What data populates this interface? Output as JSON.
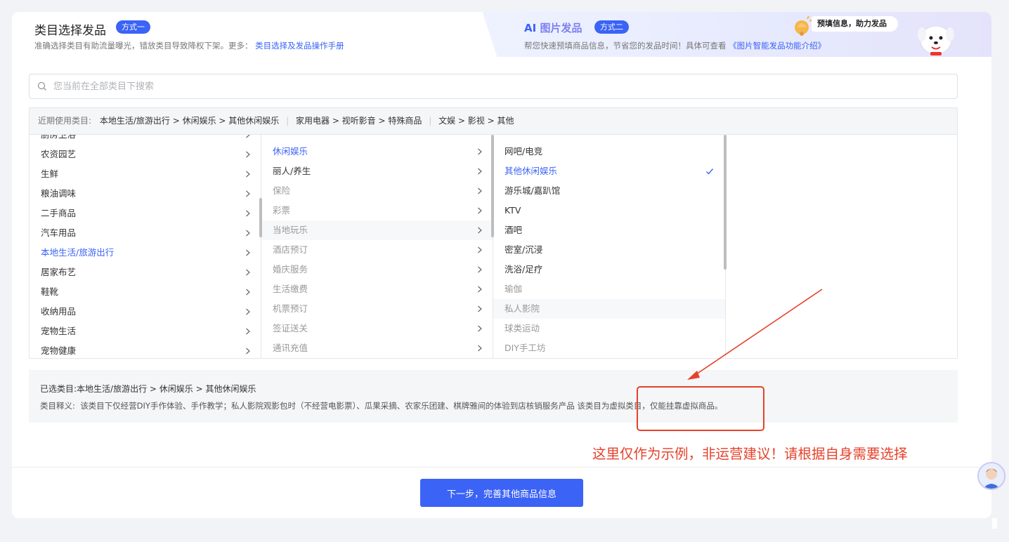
{
  "header": {
    "title": "类目选择发品",
    "mode1_badge": "方式一",
    "subtitle_text": "准确选择类目有助流量曝光，错放类目导致降权下架。更多：",
    "subtitle_link": "类目选择及发品操作手册",
    "ai_prefix": "AI",
    "ai_title": "图片发品",
    "mode2_badge": "方式二",
    "ai_subtitle_text": "帮您快速预填商品信息，节省您的发品时间！具体可查看",
    "ai_subtitle_link": "《图片智能发品功能介绍》",
    "bubble_text": "预填信息，助力发品"
  },
  "search": {
    "placeholder": "您当前在全部类目下搜索"
  },
  "recent": {
    "label": "近期使用类目:",
    "items": [
      "本地生活/旅游出行 > 休闲娱乐 > 其他休闲娱乐",
      "家用电器 > 视听影音 > 特殊商品",
      "文娱 > 影视 > 其他"
    ]
  },
  "columns": {
    "level1": [
      "厨房卫浴",
      "农资园艺",
      "生鲜",
      "粮油调味",
      "二手商品",
      "汽车用品",
      "本地生活/旅游出行",
      "居家布艺",
      "鞋靴",
      "收纳用品",
      "宠物生活",
      "宠物健康"
    ],
    "level2": [
      "休闲娱乐",
      "丽人/养生",
      "保险",
      "彩票",
      "当地玩乐",
      "酒店预订",
      "婚庆服务",
      "生活缴费",
      "机票预订",
      "签证送关",
      "通讯充值"
    ],
    "level3": [
      "网吧/电竞",
      "其他休闲娱乐",
      "游乐城/嘉趴馆",
      "KTV",
      "酒吧",
      "密室/沉浸",
      "洗浴/足疗",
      "瑜伽",
      "私人影院",
      "球类运动",
      "DIY手工坊"
    ]
  },
  "selected": {
    "label": "已选类目:",
    "path": "本地生活/旅游出行 > 休闲娱乐 > 其他休闲娱乐",
    "definition_label": "类目释义:",
    "definition": "该类目下仅经营DIY手作体验、手作教学；私人影院观影包时（不经营电影票）、瓜果采摘、农家乐团建、棋牌雅间的体验到店核销服务产品 该类目为虚拟类目，仅能挂靠虚拟商品。"
  },
  "next_button": "下一步，完善其他商品信息",
  "annotation": "这里仅作为示例，非运营建议！请根据自身需要选择",
  "colors": {
    "primary": "#3b63f5",
    "annotation_red": "#e6412b"
  }
}
